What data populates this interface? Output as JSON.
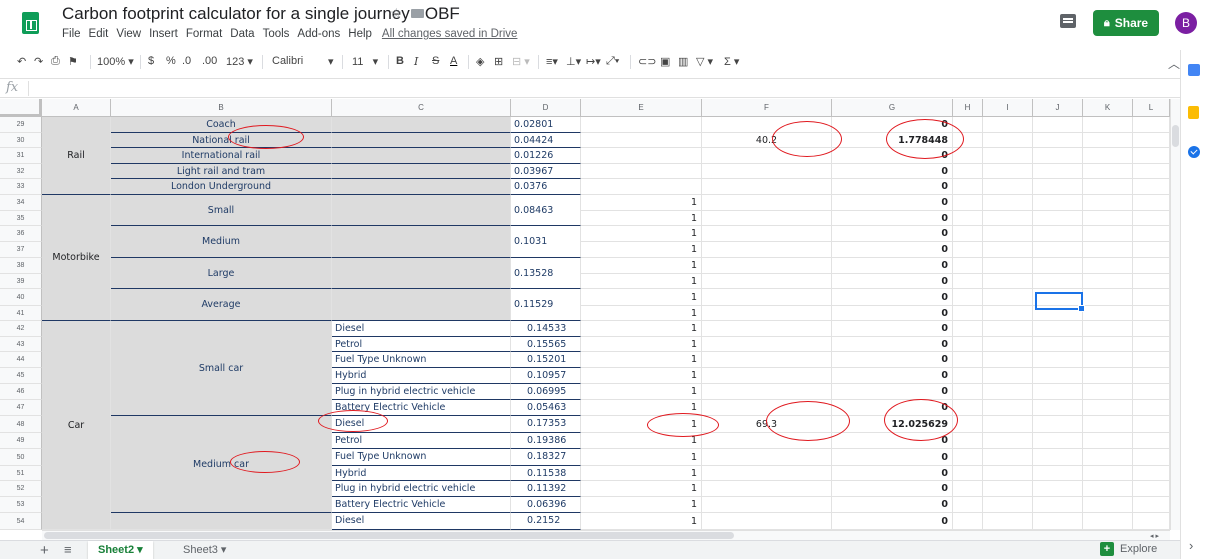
{
  "header": {
    "title": "Carbon footprint calculator for a single journey - OBF",
    "menu": [
      "File",
      "Edit",
      "View",
      "Insert",
      "Format",
      "Data",
      "Tools",
      "Add-ons",
      "Help"
    ],
    "save_status": "All changes saved in Drive",
    "share_label": "Share",
    "avatar_letter": "B"
  },
  "toolbar": {
    "zoom": "100%",
    "currency": "$",
    "percent": "%",
    "decrease_decimal": ".0",
    "increase_decimal": ".00",
    "more_formats": "123",
    "font": "Calibri",
    "font_size": "11",
    "bold": "B",
    "italic": "I",
    "strike": "S",
    "text_color": "A",
    "icons": [
      "undo-icon",
      "redo-icon",
      "print-icon",
      "paint-format-icon",
      "fill-color-icon",
      "borders-icon",
      "merge-icon",
      "align-icon",
      "valign-icon",
      "wrap-icon",
      "rotate-icon",
      "link-icon",
      "comment-icon",
      "chart-icon",
      "filter-icon",
      "functions-icon",
      "collapse-icon"
    ]
  },
  "formula_bar": {
    "fx": "fx"
  },
  "grid": {
    "columns": [
      "A",
      "B",
      "C",
      "D",
      "E",
      "F",
      "G",
      "H",
      "I",
      "J",
      "K",
      "L"
    ],
    "rows": [
      "29",
      "30",
      "31",
      "32",
      "33",
      "34",
      "35",
      "36",
      "37",
      "38",
      "39",
      "40",
      "41",
      "42",
      "43",
      "44",
      "45",
      "46",
      "47",
      "48",
      "49",
      "50",
      "51",
      "52",
      "53",
      "54"
    ],
    "a": {
      "rail": "Rail",
      "motorbike": "Motorbike",
      "car": "Car"
    },
    "b": {
      "coach": "Coach",
      "national_rail": "National rail",
      "international_rail": "International rail",
      "light_rail": "Light rail and tram",
      "underground": "London Underground",
      "small": "Small",
      "medium": "Medium",
      "large": "Large",
      "average": "Average",
      "small_car": "Small car",
      "medium_car": "Medium car"
    },
    "c": {
      "r42": "Diesel",
      "r43": "Petrol",
      "r44": "Fuel Type Unknown",
      "r45": "Hybrid",
      "r46": "Plug in hybrid electric vehicle",
      "r47": "Battery Electric Vehicle",
      "r48": "Diesel",
      "r49": "Petrol",
      "r50": "Fuel Type Unknown",
      "r51": "Hybrid",
      "r52": "Plug in hybrid electric vehicle",
      "r53": "Battery Electric Vehicle",
      "r54": "Diesel"
    },
    "d": {
      "r29": "0.02801",
      "r30": "0.04424",
      "r31": "0.01226",
      "r32": "0.03967",
      "r33": "0.0376",
      "m34": "0.08463",
      "m36": "0.1031",
      "m38": "0.13528",
      "m40": "0.11529",
      "r42": "0.14533",
      "r43": "0.15565",
      "r44": "0.15201",
      "r45": "0.10957",
      "r46": "0.06995",
      "r47": "0.05463",
      "r48": "0.17353",
      "r49": "0.19386",
      "r50": "0.18327",
      "r51": "0.11538",
      "r52": "0.11392",
      "r53": "0.06396",
      "r54": "0.2152"
    },
    "e": {
      "r34": "1",
      "r35": "1",
      "r36": "1",
      "r37": "1",
      "r38": "1",
      "r39": "1",
      "r40": "1",
      "r41": "1",
      "r42": "1",
      "r43": "1",
      "r44": "1",
      "r45": "1",
      "r46": "1",
      "r47": "1",
      "r48": "1",
      "r49": "1",
      "r50": "1",
      "r51": "1",
      "r52": "1",
      "r53": "1",
      "r54": "1"
    },
    "f": {
      "r30": "40.2",
      "r48": "69.3"
    },
    "g": {
      "r29": "0",
      "r30": "1.778448",
      "r31": "0",
      "r32": "0",
      "r33": "0",
      "r34": "0",
      "r35": "0",
      "r36": "0",
      "r37": "0",
      "r38": "0",
      "r39": "0",
      "r40": "0",
      "r41": "0",
      "r42": "0",
      "r43": "0",
      "r44": "0",
      "r45": "0",
      "r46": "0",
      "r47": "0",
      "r48": "12.025629",
      "r49": "0",
      "r50": "0",
      "r51": "0",
      "r52": "0",
      "r53": "0",
      "r54": "0"
    }
  },
  "sheets": {
    "tabs": [
      "Sheet2",
      "Sheet3"
    ],
    "active": "Sheet2",
    "explore_label": "Explore"
  },
  "colors": {
    "accent_green": "#1e8e3e",
    "annotation_red": "#e0191f",
    "selection_blue": "#1a73e8",
    "merged_gray": "#dcdcdc"
  }
}
